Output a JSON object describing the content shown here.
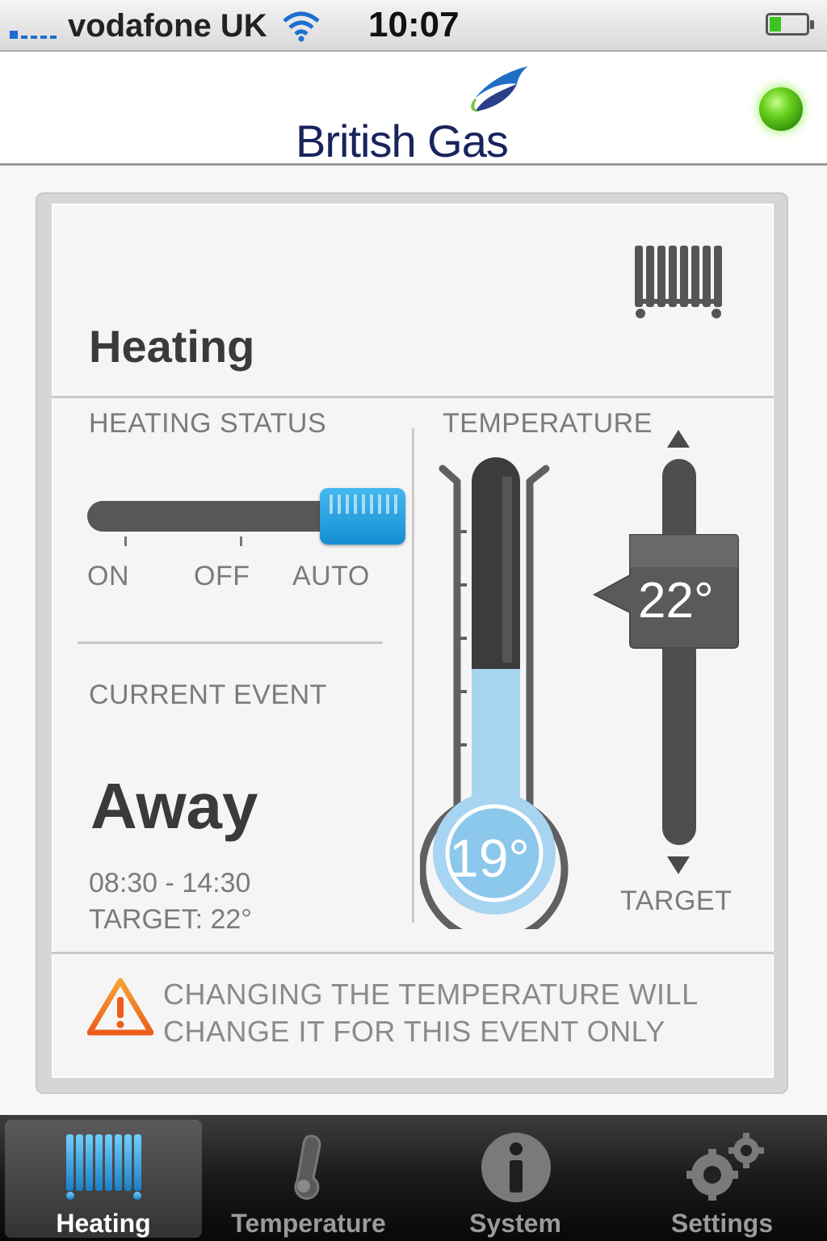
{
  "status_bar": {
    "carrier": "vodafone UK",
    "time": "10:07"
  },
  "header": {
    "brand": "British Gas",
    "connection_status_color": "#5fc71a"
  },
  "card": {
    "title": "Heating",
    "heating_status": {
      "label": "HEATING STATUS",
      "options": [
        "ON",
        "OFF",
        "AUTO"
      ],
      "selected": "AUTO"
    },
    "current_event": {
      "label": "CURRENT EVENT",
      "name": "Away",
      "time_range": "08:30 - 14:30",
      "target": "TARGET: 22°"
    },
    "temperature": {
      "label": "TEMPERATURE",
      "current": "19°",
      "target_value": "22°",
      "target_label": "TARGET"
    },
    "warning": {
      "line1": "CHANGING THE TEMPERATURE WILL",
      "line2": "CHANGE IT FOR THIS EVENT ONLY"
    }
  },
  "tabs": [
    {
      "label": "Heating",
      "icon": "radiator-icon",
      "active": true
    },
    {
      "label": "Temperature",
      "icon": "thermometer-icon",
      "active": false
    },
    {
      "label": "System",
      "icon": "info-icon",
      "active": false
    },
    {
      "label": "Settings",
      "icon": "gears-icon",
      "active": false
    }
  ],
  "colors": {
    "accent_blue": "#1a9ad8",
    "thermometer_fill": "#a7d4f0",
    "brand_navy": "#18245c"
  }
}
